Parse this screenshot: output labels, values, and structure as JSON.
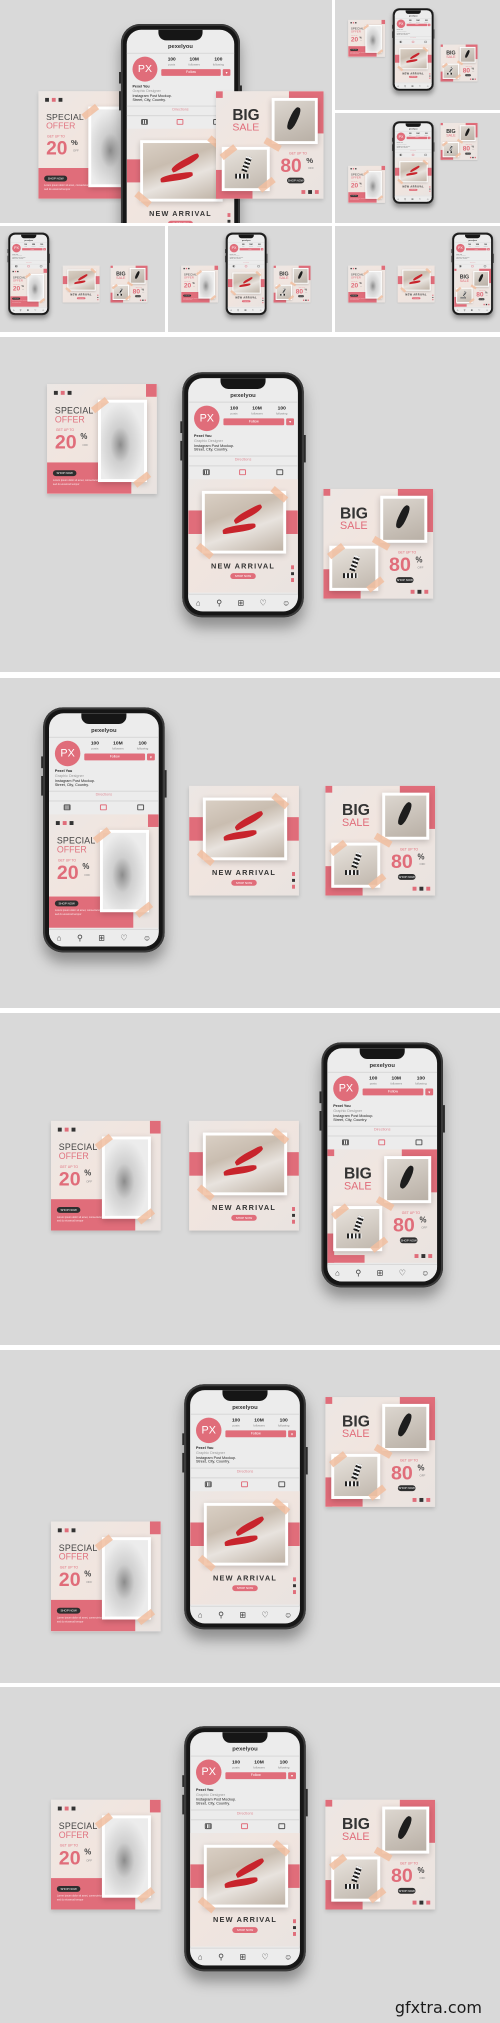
{
  "profile": {
    "username": "pexelyou",
    "avatar_initials": "PX",
    "stats": [
      {
        "value": "100",
        "label": "posts"
      },
      {
        "value": "10M",
        "label": "followers"
      },
      {
        "value": "100",
        "label": "following"
      }
    ],
    "follow_label": "Follow",
    "more_label": "▾",
    "bio": {
      "name": "Pexel You",
      "role": "Graphic Designer",
      "line1": "Instagram Post Mockup.",
      "line2": "Street, City, Country."
    },
    "directions_label": "Directions",
    "tabs": [
      "grid-icon",
      "reels-icon",
      "tagged-icon"
    ],
    "nav_icons": [
      {
        "name": "home-icon",
        "glyph": "⌂"
      },
      {
        "name": "search-icon",
        "glyph": "⚲"
      },
      {
        "name": "add-icon",
        "glyph": "⊞"
      },
      {
        "name": "heart-icon",
        "glyph": "♡"
      },
      {
        "name": "profile-icon",
        "glyph": "☺"
      }
    ]
  },
  "posts": {
    "special_offer": {
      "title_line1": "SPECIAL",
      "title_line2": "OFFER",
      "get_up_to": "GET UP TO",
      "value": "20",
      "percent": "%",
      "off": "OFF",
      "button": "SHOP NOW",
      "body": "Lorem ipsum dolor sit amet, consectetur adipiscing elit sed do eiusmod tempor"
    },
    "new_arrival": {
      "title": "NEW ARRIVAL",
      "button": "SHOP NOW"
    },
    "big_sale": {
      "title_line1": "BIG",
      "title_line2": "SALE",
      "get_up_to": "GET UP TO",
      "value": "80",
      "percent": "%",
      "off": "OFF",
      "button": "SHOP NOW"
    }
  },
  "colors": {
    "accent": "#e06d7a",
    "dark": "#333333",
    "background": "#d9d9d9",
    "tape": "#f1bea0"
  },
  "watermark": "gfxtra.com"
}
